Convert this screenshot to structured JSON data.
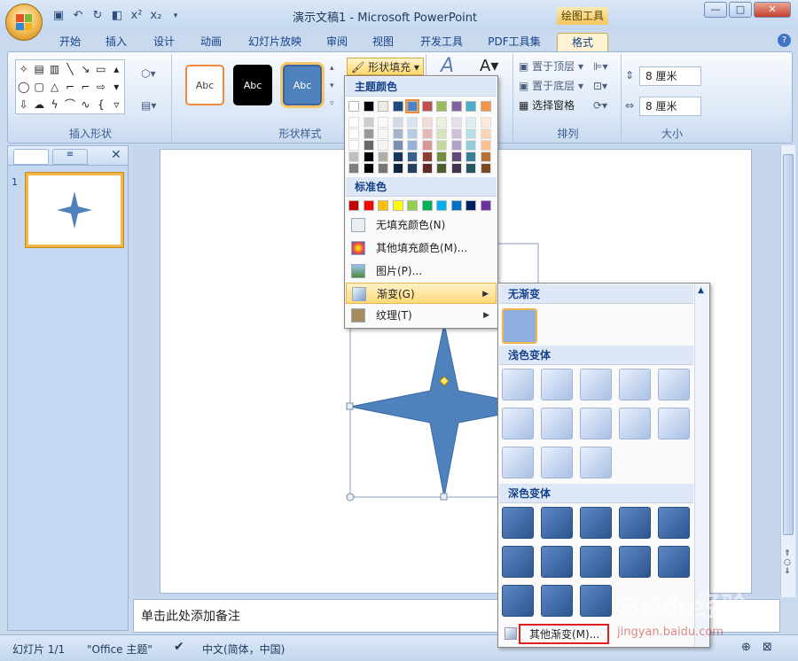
{
  "window": {
    "title": "演示文稿1 - Microsoft PowerPoint",
    "context_tab": "绘图工具"
  },
  "tabs": [
    "开始",
    "插入",
    "设计",
    "动画",
    "幻灯片放映",
    "审阅",
    "视图",
    "开发工具",
    "PDF工具集",
    "格式"
  ],
  "ribbon": {
    "insert_shapes_label": "插入形状",
    "shape_styles_label": "形状样式",
    "arrange_label": "排列",
    "size_label": "大小",
    "style_sample": "Abc",
    "shape_fill": "形状填充",
    "bring_front": "置于顶层",
    "send_back": "置于底层",
    "selection_pane": "选择窗格",
    "height_value": "8 厘米",
    "width_value": "8 厘米"
  },
  "fill_menu": {
    "theme_colors": "主题颜色",
    "standard_colors": "标准色",
    "no_fill": "无填充颜色(N)",
    "more_colors": "其他填充颜色(M)...",
    "picture": "图片(P)...",
    "gradient": "渐变(G)",
    "texture": "纹理(T)",
    "theme_top_row": [
      "#ffffff",
      "#000000",
      "#eeece1",
      "#1f497d",
      "#4f81bd",
      "#c0504d",
      "#9bbb59",
      "#8064a2",
      "#4bacc6",
      "#f79646"
    ],
    "standard_row": [
      "#c00000",
      "#ff0000",
      "#ffc000",
      "#ffff00",
      "#92d050",
      "#00b050",
      "#00b0f0",
      "#0070c0",
      "#002060",
      "#7030a0"
    ]
  },
  "gradient_menu": {
    "no_gradient": "无渐变",
    "light_variations": "浅色变体",
    "dark_variations": "深色变体",
    "more_gradients": "其他渐变(M)..."
  },
  "slide_panel": {
    "thumb_number": "1"
  },
  "notes_placeholder": "单击此处添加备注",
  "status": {
    "slide": "幻灯片 1/1",
    "theme": "\"Office 主题\"",
    "language": "中文(简体，中国)"
  },
  "watermark": "Baidu经验",
  "watermark_url": "jingyan.baidu.com"
}
